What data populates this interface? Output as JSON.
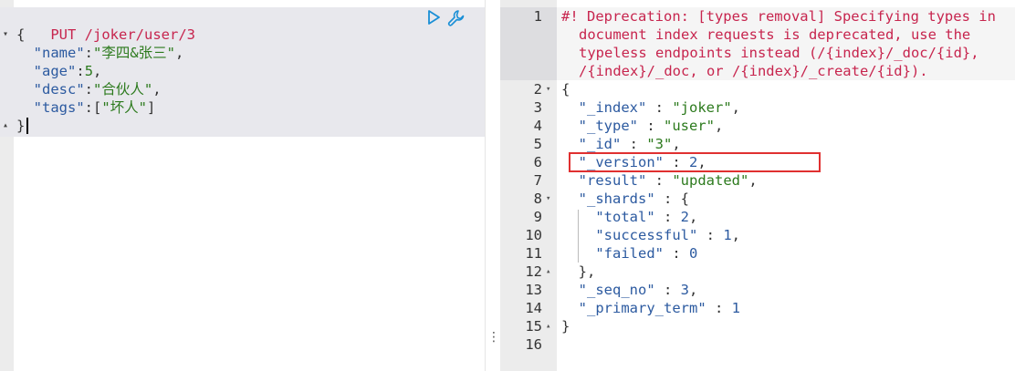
{
  "request": {
    "method": "PUT",
    "url": "/joker/user/3",
    "lines": [
      {
        "punct": "{"
      },
      {
        "key": "\"name\"",
        "sep": ":",
        "val": "\"李四&张三\"",
        "tail": ","
      },
      {
        "key": "\"age\"",
        "sep": ":",
        "val": "5",
        "tail": ","
      },
      {
        "key": "\"desc\"",
        "sep": ":",
        "val": "\"合伙人\"",
        "tail": ","
      },
      {
        "key": "\"tags\"",
        "sep": ":[",
        "val": "\"坏人\"",
        "tail": "]"
      },
      {
        "punct": "}"
      }
    ]
  },
  "toolbar": {
    "run_icon": "play-icon",
    "settings_icon": "wrench-icon"
  },
  "response": {
    "warning_lines": [
      "#! Deprecation: [types removal] Specifying types in",
      "document index requests is deprecated, use the",
      "typeless endpoints instead (/{index}/_doc/{id},",
      "/{index}/_doc, or /{index}/_create/{id})."
    ],
    "line_numbers": [
      "1",
      "2",
      "3",
      "4",
      "5",
      "6",
      "7",
      "8",
      "9",
      "10",
      "11",
      "12",
      "13",
      "14",
      "15",
      "16"
    ],
    "lines": [
      {
        "n": "2",
        "text_punct": "{"
      },
      {
        "n": "3",
        "key": "\"_index\"",
        "sep": " : ",
        "val": "\"joker\"",
        "tail": ","
      },
      {
        "n": "4",
        "key": "\"_type\"",
        "sep": " : ",
        "val": "\"user\"",
        "tail": ","
      },
      {
        "n": "5",
        "key": "\"_id\"",
        "sep": " : ",
        "val": "\"3\"",
        "tail": ","
      },
      {
        "n": "6",
        "key": "\"_version\"",
        "sep": " : ",
        "val": "2",
        "tail": ","
      },
      {
        "n": "7",
        "key": "\"result\"",
        "sep": " : ",
        "val": "\"updated\"",
        "tail": ","
      },
      {
        "n": "8",
        "key": "\"_shards\"",
        "sep": " : ",
        "val": "{",
        "tail": ""
      },
      {
        "n": "9",
        "key": "\"total\"",
        "sep": " : ",
        "val": "2",
        "tail": ","
      },
      {
        "n": "10",
        "key": "\"successful\"",
        "sep": " : ",
        "val": "1",
        "tail": ","
      },
      {
        "n": "11",
        "key": "\"failed\"",
        "sep": " : ",
        "val": "0",
        "tail": ""
      },
      {
        "n": "12",
        "text_punct": "},"
      },
      {
        "n": "13",
        "key": "\"_seq_no\"",
        "sep": " : ",
        "val": "3",
        "tail": ","
      },
      {
        "n": "14",
        "key": "\"_primary_term\"",
        "sep": " : ",
        "val": "1",
        "tail": ""
      },
      {
        "n": "15",
        "text_punct": "}"
      }
    ]
  },
  "splitter_glyph": "⋮",
  "colors": {
    "highlight_box": "#e03030",
    "method": "#c7254e",
    "key": "#2c5aa0",
    "string": "#2c7a1d"
  }
}
